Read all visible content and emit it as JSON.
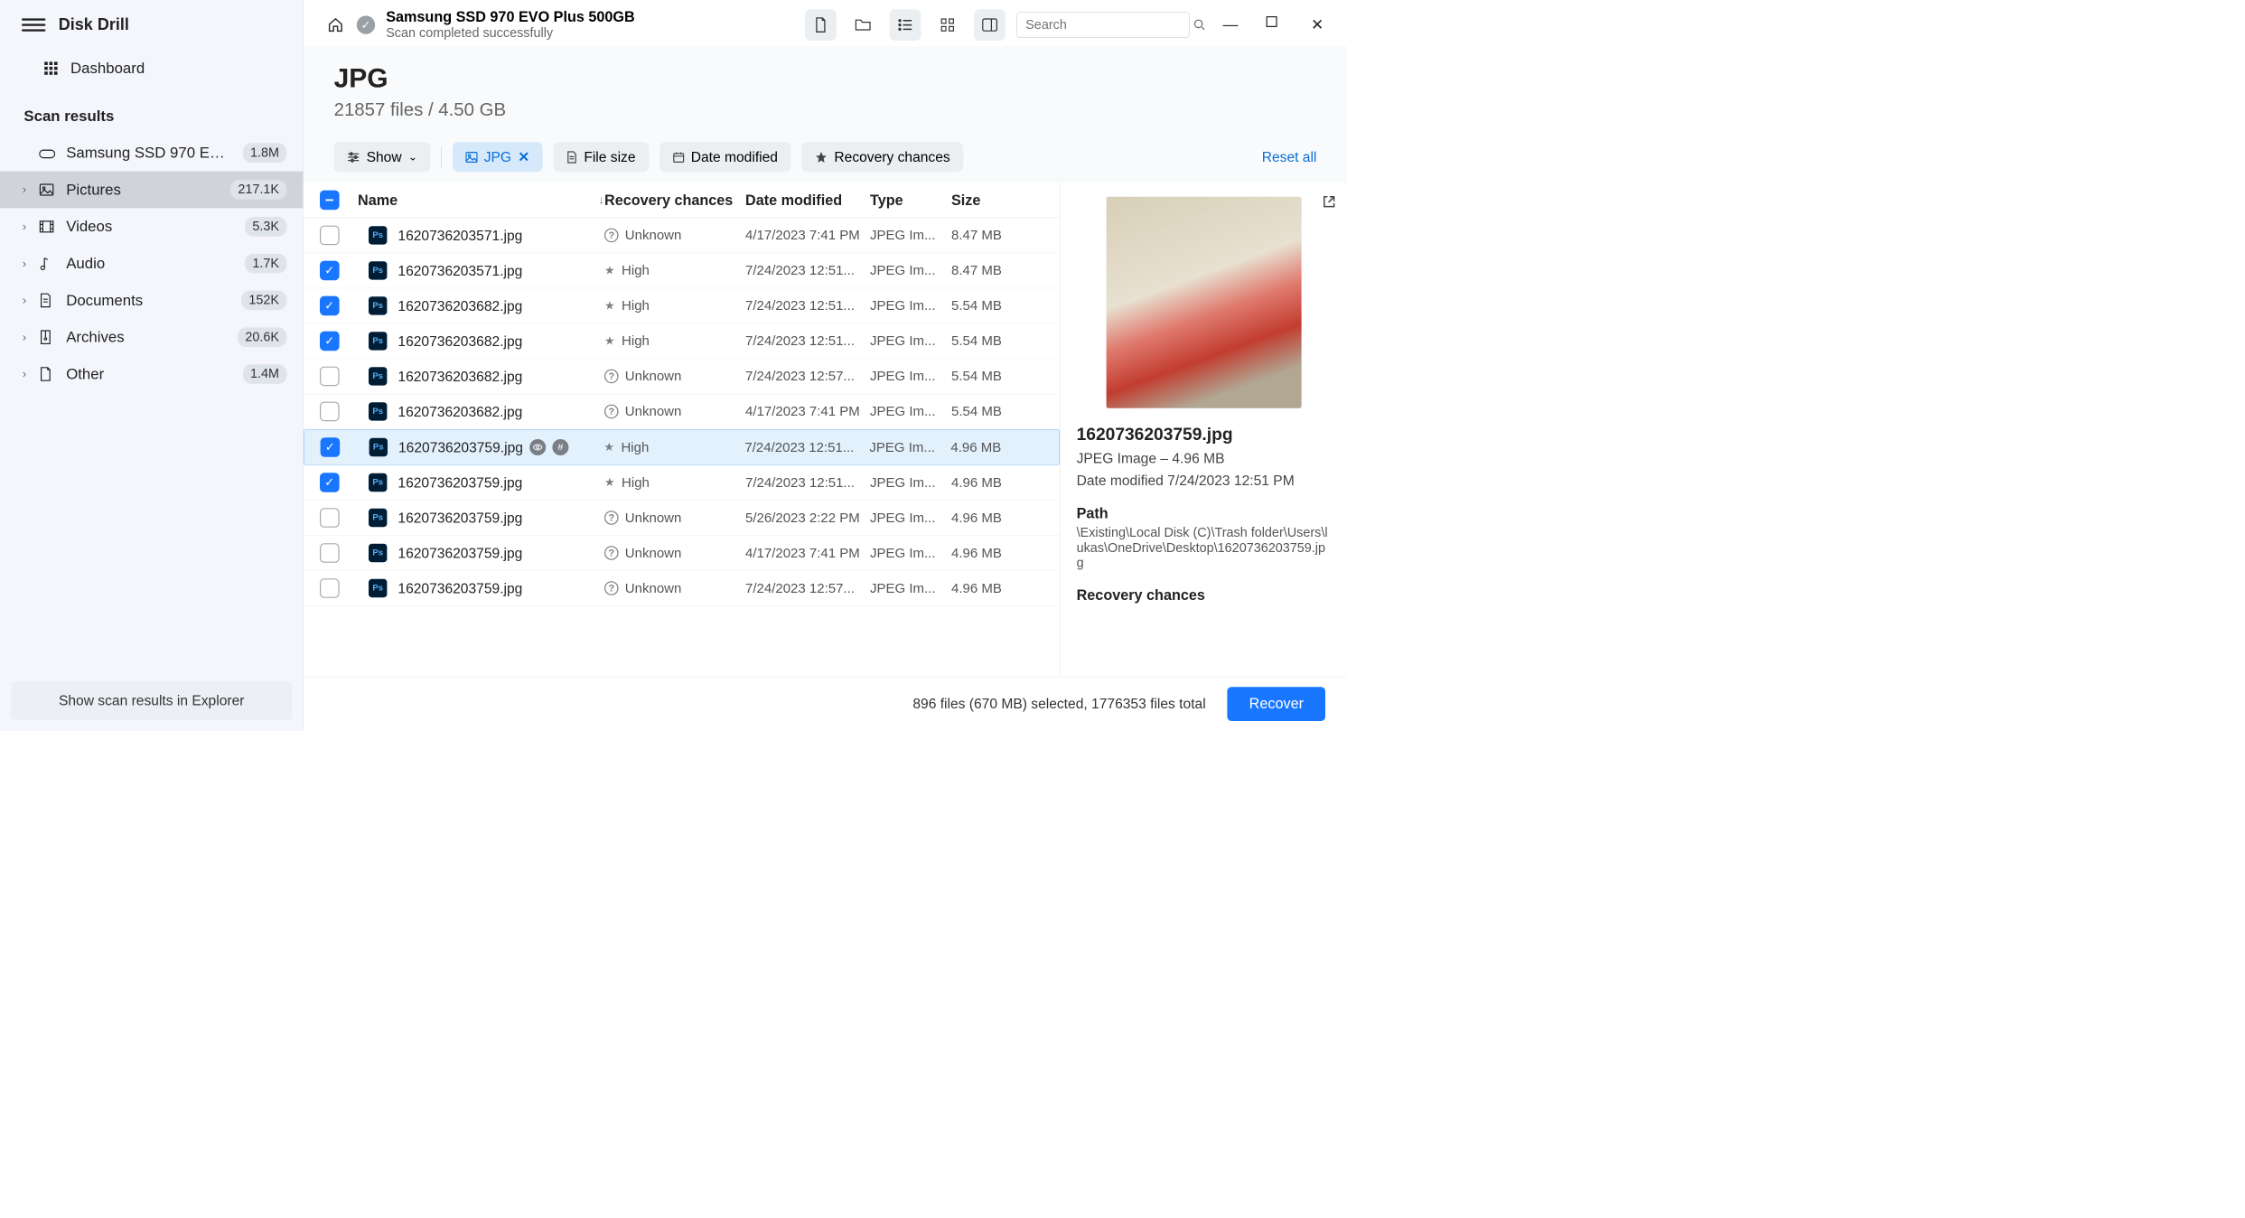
{
  "app": {
    "name": "Disk Drill"
  },
  "sidebar": {
    "dashboard": "Dashboard",
    "section_label": "Scan results",
    "drive": {
      "label": "Samsung SSD 970 EVO...",
      "count": "1.8M"
    },
    "categories": [
      {
        "key": "pictures",
        "label": "Pictures",
        "count": "217.1K",
        "icon": "image"
      },
      {
        "key": "videos",
        "label": "Videos",
        "count": "5.3K",
        "icon": "film"
      },
      {
        "key": "audio",
        "label": "Audio",
        "count": "1.7K",
        "icon": "note"
      },
      {
        "key": "documents",
        "label": "Documents",
        "count": "152K",
        "icon": "doc"
      },
      {
        "key": "archives",
        "label": "Archives",
        "count": "20.6K",
        "icon": "zip"
      },
      {
        "key": "other",
        "label": "Other",
        "count": "1.4M",
        "icon": "page"
      }
    ],
    "show_in_explorer": "Show scan results in Explorer"
  },
  "titlebar": {
    "drive_name": "Samsung SSD 970 EVO Plus 500GB",
    "status": "Scan completed successfully",
    "search_placeholder": "Search"
  },
  "page": {
    "title": "JPG",
    "subtitle": "21857 files / 4.50 GB"
  },
  "filters": {
    "show": "Show",
    "chips": [
      {
        "label": "JPG",
        "icon": "image",
        "active": true
      },
      {
        "label": "File size",
        "icon": "doc"
      },
      {
        "label": "Date modified",
        "icon": "cal"
      },
      {
        "label": "Recovery chances",
        "icon": "star"
      }
    ],
    "reset": "Reset all"
  },
  "table": {
    "headers": {
      "name": "Name",
      "recovery": "Recovery chances",
      "date": "Date modified",
      "type": "Type",
      "size": "Size"
    },
    "rows": [
      {
        "checked": false,
        "name": "1620736203571.jpg",
        "recovery": "Unknown",
        "date": "4/17/2023 7:41 PM",
        "type": "JPEG Im...",
        "size": "8.47 MB"
      },
      {
        "checked": true,
        "name": "1620736203571.jpg",
        "recovery": "High",
        "date": "7/24/2023 12:51...",
        "type": "JPEG Im...",
        "size": "8.47 MB"
      },
      {
        "checked": true,
        "name": "1620736203682.jpg",
        "recovery": "High",
        "date": "7/24/2023 12:51...",
        "type": "JPEG Im...",
        "size": "5.54 MB"
      },
      {
        "checked": true,
        "name": "1620736203682.jpg",
        "recovery": "High",
        "date": "7/24/2023 12:51...",
        "type": "JPEG Im...",
        "size": "5.54 MB"
      },
      {
        "checked": false,
        "name": "1620736203682.jpg",
        "recovery": "Unknown",
        "date": "7/24/2023 12:57...",
        "type": "JPEG Im...",
        "size": "5.54 MB"
      },
      {
        "checked": false,
        "name": "1620736203682.jpg",
        "recovery": "Unknown",
        "date": "4/17/2023 7:41 PM",
        "type": "JPEG Im...",
        "size": "5.54 MB"
      },
      {
        "checked": true,
        "selected": true,
        "name": "1620736203759.jpg",
        "recovery": "High",
        "date": "7/24/2023 12:51...",
        "type": "JPEG Im...",
        "size": "4.96 MB",
        "badges": true
      },
      {
        "checked": true,
        "name": "1620736203759.jpg",
        "recovery": "High",
        "date": "7/24/2023 12:51...",
        "type": "JPEG Im...",
        "size": "4.96 MB"
      },
      {
        "checked": false,
        "name": "1620736203759.jpg",
        "recovery": "Unknown",
        "date": "5/26/2023 2:22 PM",
        "type": "JPEG Im...",
        "size": "4.96 MB"
      },
      {
        "checked": false,
        "name": "1620736203759.jpg",
        "recovery": "Unknown",
        "date": "4/17/2023 7:41 PM",
        "type": "JPEG Im...",
        "size": "4.96 MB"
      },
      {
        "checked": false,
        "name": "1620736203759.jpg",
        "recovery": "Unknown",
        "date": "7/24/2023 12:57...",
        "type": "JPEG Im...",
        "size": "4.96 MB"
      }
    ]
  },
  "preview": {
    "name": "1620736203759.jpg",
    "meta": "JPEG Image – 4.96 MB",
    "date_label": "Date modified 7/24/2023 12:51 PM",
    "path_label": "Path",
    "path": "\\Existing\\Local Disk (C)\\Trash folder\\Users\\lukas\\OneDrive\\Desktop\\1620736203759.jpg",
    "recovery_label": "Recovery chances"
  },
  "footer": {
    "status": "896 files (670 MB) selected, 1776353 files total",
    "recover": "Recover"
  }
}
